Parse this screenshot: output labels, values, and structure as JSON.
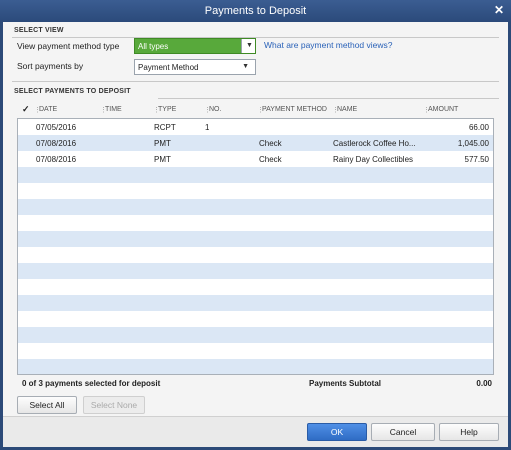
{
  "window": {
    "title": "Payments to Deposit",
    "close_glyph": "✕"
  },
  "select_view": {
    "section_label": "SELECT VIEW",
    "method_type_label": "View payment method type",
    "method_type_value": "All types",
    "sort_label": "Sort payments by",
    "sort_value": "Payment Method",
    "help_link": "What are payment method views?"
  },
  "payments": {
    "section_label": "SELECT PAYMENTS TO DEPOSIT",
    "columns": {
      "check": "✓",
      "date": "DATE",
      "time": "TIME",
      "type": "TYPE",
      "no": "NO.",
      "method": "PAYMENT METHOD",
      "name": "NAME",
      "amount": "AMOUNT"
    },
    "rows": [
      {
        "date": "07/05/2016",
        "time": "",
        "type": "RCPT",
        "no": "1",
        "method": "",
        "name": "",
        "amount": "66.00"
      },
      {
        "date": "07/08/2016",
        "time": "",
        "type": "PMT",
        "no": "",
        "method": "Check",
        "name": "Castlerock Coffee Ho...",
        "amount": "1,045.00"
      },
      {
        "date": "07/08/2016",
        "time": "",
        "type": "PMT",
        "no": "",
        "method": "Check",
        "name": "Rainy Day Collectibles",
        "amount": "577.50"
      }
    ],
    "empty_rows": 13,
    "selected_summary": "0 of 3 payments selected for deposit",
    "subtotal_label": "Payments Subtotal",
    "subtotal_value": "0.00"
  },
  "buttons": {
    "select_all": "Select All",
    "select_none": "Select None",
    "ok": "OK",
    "cancel": "Cancel",
    "help": "Help"
  }
}
